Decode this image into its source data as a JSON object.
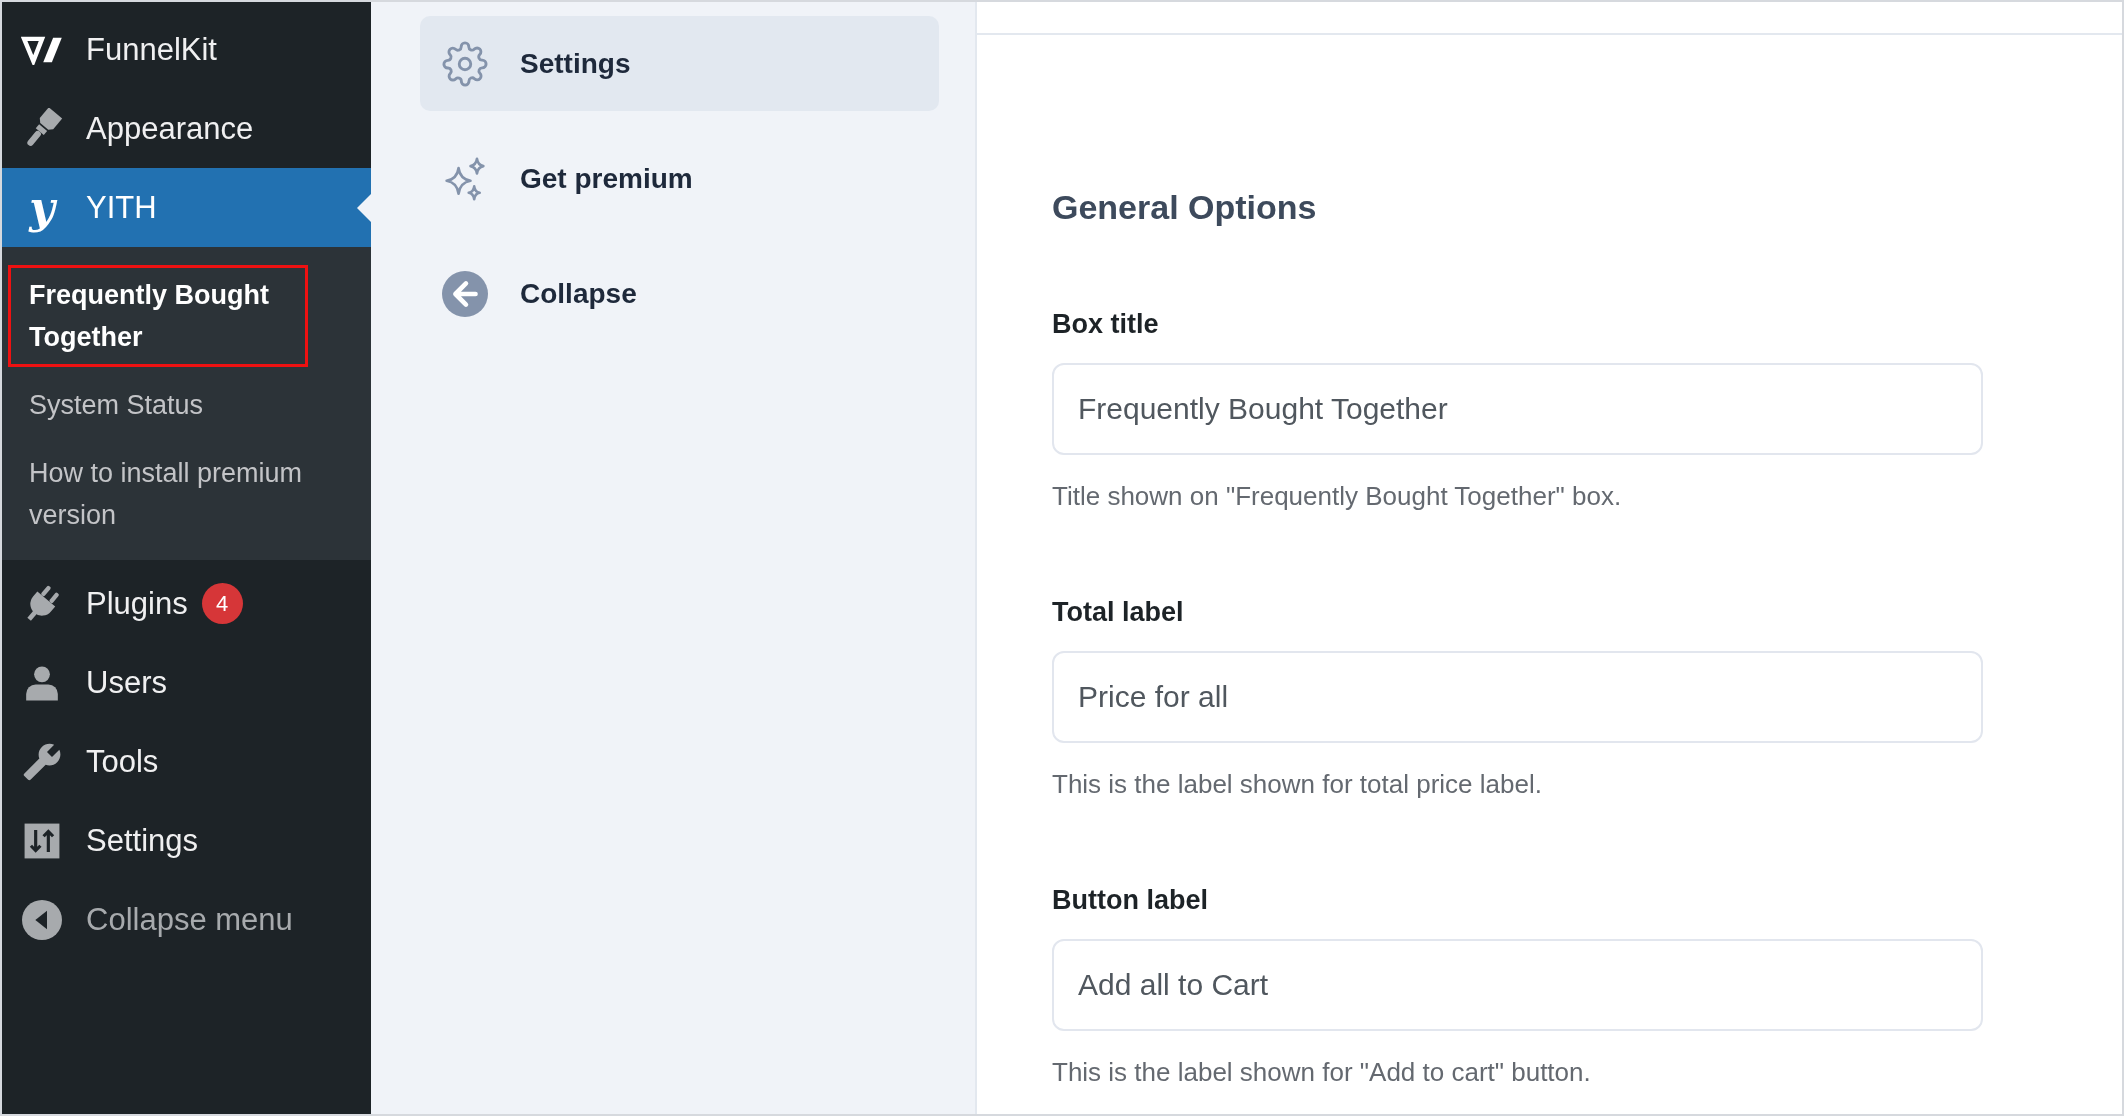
{
  "admin_menu": {
    "items": [
      {
        "label": "FunnelKit",
        "selected": false
      },
      {
        "label": "Appearance",
        "selected": false
      },
      {
        "label": "YITH",
        "logo": "y",
        "selected": true,
        "children": [
          {
            "label": "Frequently Bought Together",
            "selected": true,
            "highlighted": true
          },
          {
            "label": "System Status",
            "selected": false,
            "highlighted": false
          },
          {
            "label": "How to install premium version",
            "selected": false,
            "highlighted": false
          }
        ]
      },
      {
        "label": "Plugins",
        "badge": "4",
        "selected": false
      },
      {
        "label": "Users",
        "selected": false
      },
      {
        "label": "Tools",
        "selected": false
      },
      {
        "label": "Settings",
        "selected": false
      }
    ],
    "collapse_menu": {
      "label": "Collapse menu"
    }
  },
  "plugin_nav": {
    "items": [
      {
        "label": "Settings",
        "selected": true
      },
      {
        "label": "Get premium",
        "selected": false
      },
      {
        "label": "Collapse",
        "selected": false
      }
    ]
  },
  "settings": {
    "heading": "General Options",
    "fields": [
      {
        "label": "Box title",
        "value": "Frequently Bought Together",
        "description": "Title shown on \"Frequently Bought Together\" box."
      },
      {
        "label": "Total label",
        "value": "Price for all",
        "description": "This is the label shown for total price label."
      },
      {
        "label": "Button label",
        "value": "Add all to Cart",
        "description": "This is the label shown for \"Add to cart\" button."
      }
    ]
  }
}
